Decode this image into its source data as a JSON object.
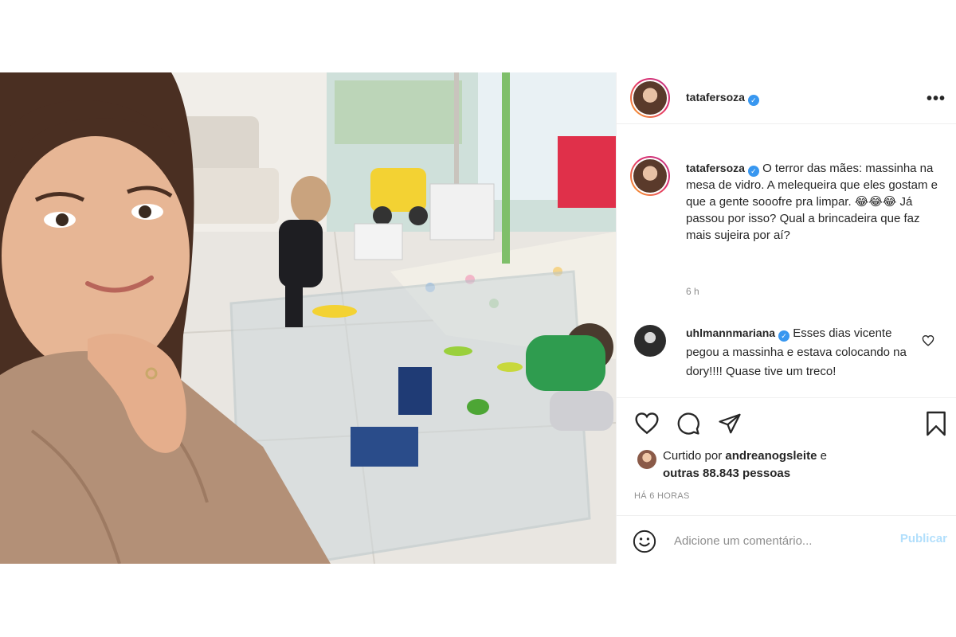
{
  "post": {
    "username": "tatafersoza",
    "verified_mark": "✓",
    "more_icon": "more-horizontal-icon",
    "caption": "O terror das mães: massinha na mesa de vidro. A melequeira que eles gostam e que a gente sooofre pra limpar. 😂😂😂 Já passou por isso? Qual a brincadeira que faz mais sujeira por aí?",
    "caption_age": "6 h"
  },
  "comment": {
    "username": "uhlmannmariana",
    "verified_mark": "✓",
    "text": "Esses dias vicente pegou a massinha e estava colocando na dory!!!! Quase tive um treco!"
  },
  "likes": {
    "prefix": "Curtido por",
    "first_user": "andreanogsleite",
    "connector": "e",
    "others": "outras 88.843 pessoas"
  },
  "posted_time": "HÁ 6 HORAS",
  "add_comment": {
    "placeholder": "Adicione um comentário...",
    "publish_label": "Publicar"
  },
  "colors": {
    "verified": "#3897f0",
    "publish_disabled": "#b2dffc",
    "secondary_text": "#8e8e8e"
  }
}
